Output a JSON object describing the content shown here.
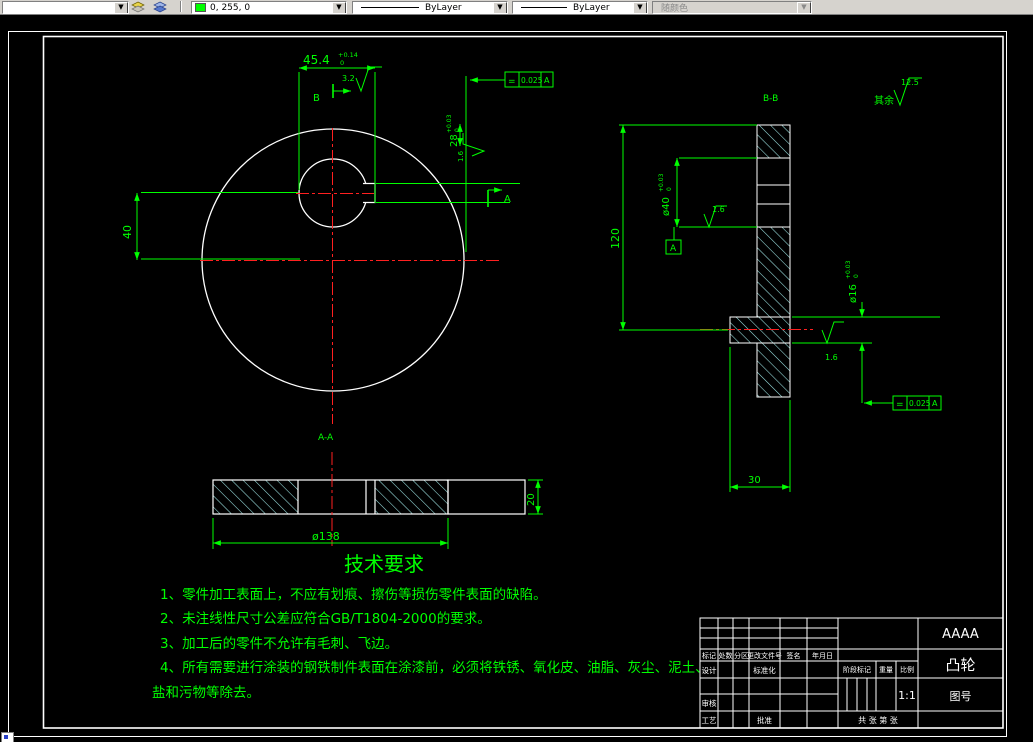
{
  "toolbar": {
    "color_combo": {
      "value": "0, 255, 0",
      "swatch_color": "#00ff00"
    },
    "linetype_combo": {
      "value": "ByLayer"
    },
    "lineweight_combo": {
      "value": "ByLayer"
    },
    "plotstyle_combo": {
      "value": "随颜色"
    }
  },
  "drawing": {
    "colors": {
      "geometry": "#ffffff",
      "annotation": "#00ff00",
      "centerline": "#ff2020",
      "hatch": "#a0e8e8"
    },
    "front": {
      "dim_keyway_width": {
        "value": "45.4",
        "tol_hi": "+0.14",
        "tol_lo": "0"
      },
      "dim_offset": "40",
      "dim_key": {
        "value": "28",
        "tol_hi": "+0.03",
        "tol_lo": "0"
      },
      "fcf": {
        "symbol": "=",
        "value": "0.025",
        "datum": "A"
      },
      "roughness_keyway": "3.2",
      "roughness_side": "1.6",
      "section_arrow_b": "B",
      "section_arrow_a": "A"
    },
    "side": {
      "label": "B-B",
      "dim_height": "120",
      "dim_bore": {
        "value": "ø40",
        "tol_hi": "+0.03",
        "tol_lo": "0"
      },
      "dim_boss": {
        "value": "ø16",
        "tol_hi": "+0.03",
        "tol_lo": "0"
      },
      "dim_width": "30",
      "fcf": {
        "symbol": "=",
        "value": "0.025",
        "datum": "A"
      },
      "datum_label": "A",
      "roughness_bore": "1.6",
      "roughness_key": "1.6",
      "others_label": "其余",
      "others_roughness": "12.5"
    },
    "bottom": {
      "label": "A-A",
      "dim_diameter": "ø138",
      "dim_thickness": "20"
    }
  },
  "tech_req": {
    "title": "技术要求",
    "lines": [
      "1、零件加工表面上，不应有划痕、擦伤等损伤零件表面的缺陷。",
      "2、未注线性尺寸公差应符合GB/T1804-2000的要求。",
      "3、加工后的零件不允许有毛刺、飞边。",
      "4、所有需要进行涂装的钢铁制件表面在涂漆前，必须将铁锈、氧化皮、油脂、灰尘、泥土、",
      "盐和污物等除去。"
    ]
  },
  "title_block": {
    "company": "AAAA",
    "part_name": "凸轮",
    "drawing_no": "图号",
    "headers": {
      "mark": "标记",
      "count": "处数",
      "zone": "分区",
      "change_file": "更改文件号",
      "sign": "签名",
      "date": "年月日"
    },
    "rows": {
      "design": "设计",
      "standardization": "标准化",
      "check": "审核",
      "process": "工艺",
      "approve": "批准"
    },
    "stage_label": "阶段标记",
    "weight_label": "重量",
    "scale_label": "比例",
    "scale_value": "1:1",
    "sheet_note": "共 张 第 张"
  }
}
